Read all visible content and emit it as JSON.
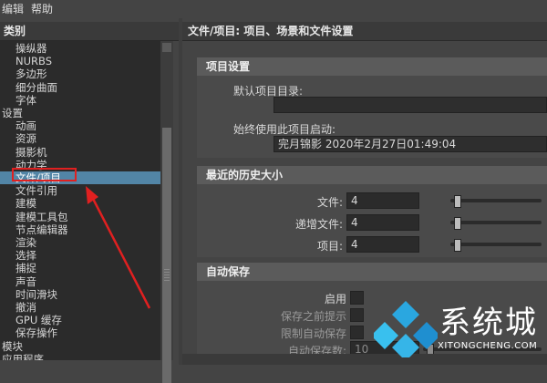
{
  "menubar": {
    "items": [
      "编辑",
      "帮助"
    ]
  },
  "left_panel": {
    "header": "类别",
    "items": [
      {
        "label": "操纵器",
        "indent": 1
      },
      {
        "label": "NURBS",
        "indent": 1
      },
      {
        "label": "多边形",
        "indent": 1
      },
      {
        "label": "细分曲面",
        "indent": 1
      },
      {
        "label": "字体",
        "indent": 1
      },
      {
        "label": "设置",
        "indent": 0
      },
      {
        "label": "动画",
        "indent": 1
      },
      {
        "label": "资源",
        "indent": 1
      },
      {
        "label": "摄影机",
        "indent": 1
      },
      {
        "label": "动力学",
        "indent": 1
      },
      {
        "label": "文件/项目",
        "indent": 1,
        "selected": true
      },
      {
        "label": "文件引用",
        "indent": 1
      },
      {
        "label": "建模",
        "indent": 1
      },
      {
        "label": "建模工具包",
        "indent": 1
      },
      {
        "label": "节点编辑器",
        "indent": 1
      },
      {
        "label": "渲染",
        "indent": 1
      },
      {
        "label": "选择",
        "indent": 1
      },
      {
        "label": "捕捉",
        "indent": 1
      },
      {
        "label": "声音",
        "indent": 1
      },
      {
        "label": "时间滑块",
        "indent": 1
      },
      {
        "label": "撤消",
        "indent": 1
      },
      {
        "label": "GPU 缓存",
        "indent": 1
      },
      {
        "label": "保存操作",
        "indent": 1
      },
      {
        "label": "模块",
        "indent": 0
      },
      {
        "label": "应用程序",
        "indent": 0
      }
    ]
  },
  "right_panel": {
    "header": "文件/项目: 项目、场景和文件设置",
    "project_settings": {
      "title": "项目设置",
      "default_dir_label": "默认项目目录:",
      "default_dir_value": "",
      "always_use_label": "始终使用此项目启动:",
      "always_use_value": "完月锦影 2020年2月27日01:49:04"
    },
    "recent_history": {
      "title": "最近的历史大小",
      "rows": [
        {
          "label": "文件:",
          "value": "4",
          "level": 0.2
        },
        {
          "label": "递增文件:",
          "value": "4",
          "level": 0.2
        },
        {
          "label": "项目:",
          "value": "4",
          "level": 0.2
        }
      ]
    },
    "auto_save": {
      "title": "自动保存",
      "enable_label": "启用",
      "prompt_label": "保存之前提示",
      "limit_label": "限制自动保存",
      "count_label": "自动保存数:",
      "count_value": "10"
    }
  },
  "watermark": {
    "text": "系统城",
    "sub": "XITONGCHENG.COM"
  },
  "colors": {
    "selection": "#5285a6",
    "annotation_red": "#e02020"
  }
}
